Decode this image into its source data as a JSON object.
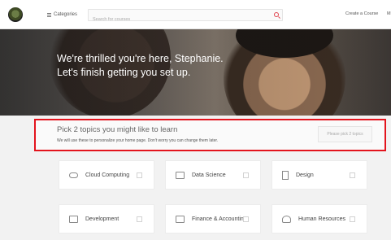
{
  "nav": {
    "categories_label": "Categories",
    "search_placeholder": "Search for courses",
    "create_course_label": "Create a Course",
    "more_label": "M"
  },
  "hero": {
    "line1": "We're thrilled you're here, Stephanie.",
    "line2": "Let's finish getting you set up."
  },
  "prompt": {
    "title": "Pick 2 topics you might like to learn",
    "subtitle": "We will use these to personalize your home page. Don't worry you can change them later.",
    "button_label": "Please pick 2 topics",
    "highlight_color": "#e3141d"
  },
  "topics": [
    {
      "label": "Cloud Computing",
      "icon": "cloud-icon",
      "checked": false
    },
    {
      "label": "Data Science",
      "icon": "chart-icon",
      "checked": false
    },
    {
      "label": "Design",
      "icon": "design-tools-icon",
      "checked": false
    },
    {
      "label": "Development",
      "icon": "code-window-icon",
      "checked": false
    },
    {
      "label": "Finance & Accounting",
      "icon": "finance-chart-icon",
      "checked": false
    },
    {
      "label": "Human Resources",
      "icon": "people-icon",
      "checked": false
    }
  ]
}
